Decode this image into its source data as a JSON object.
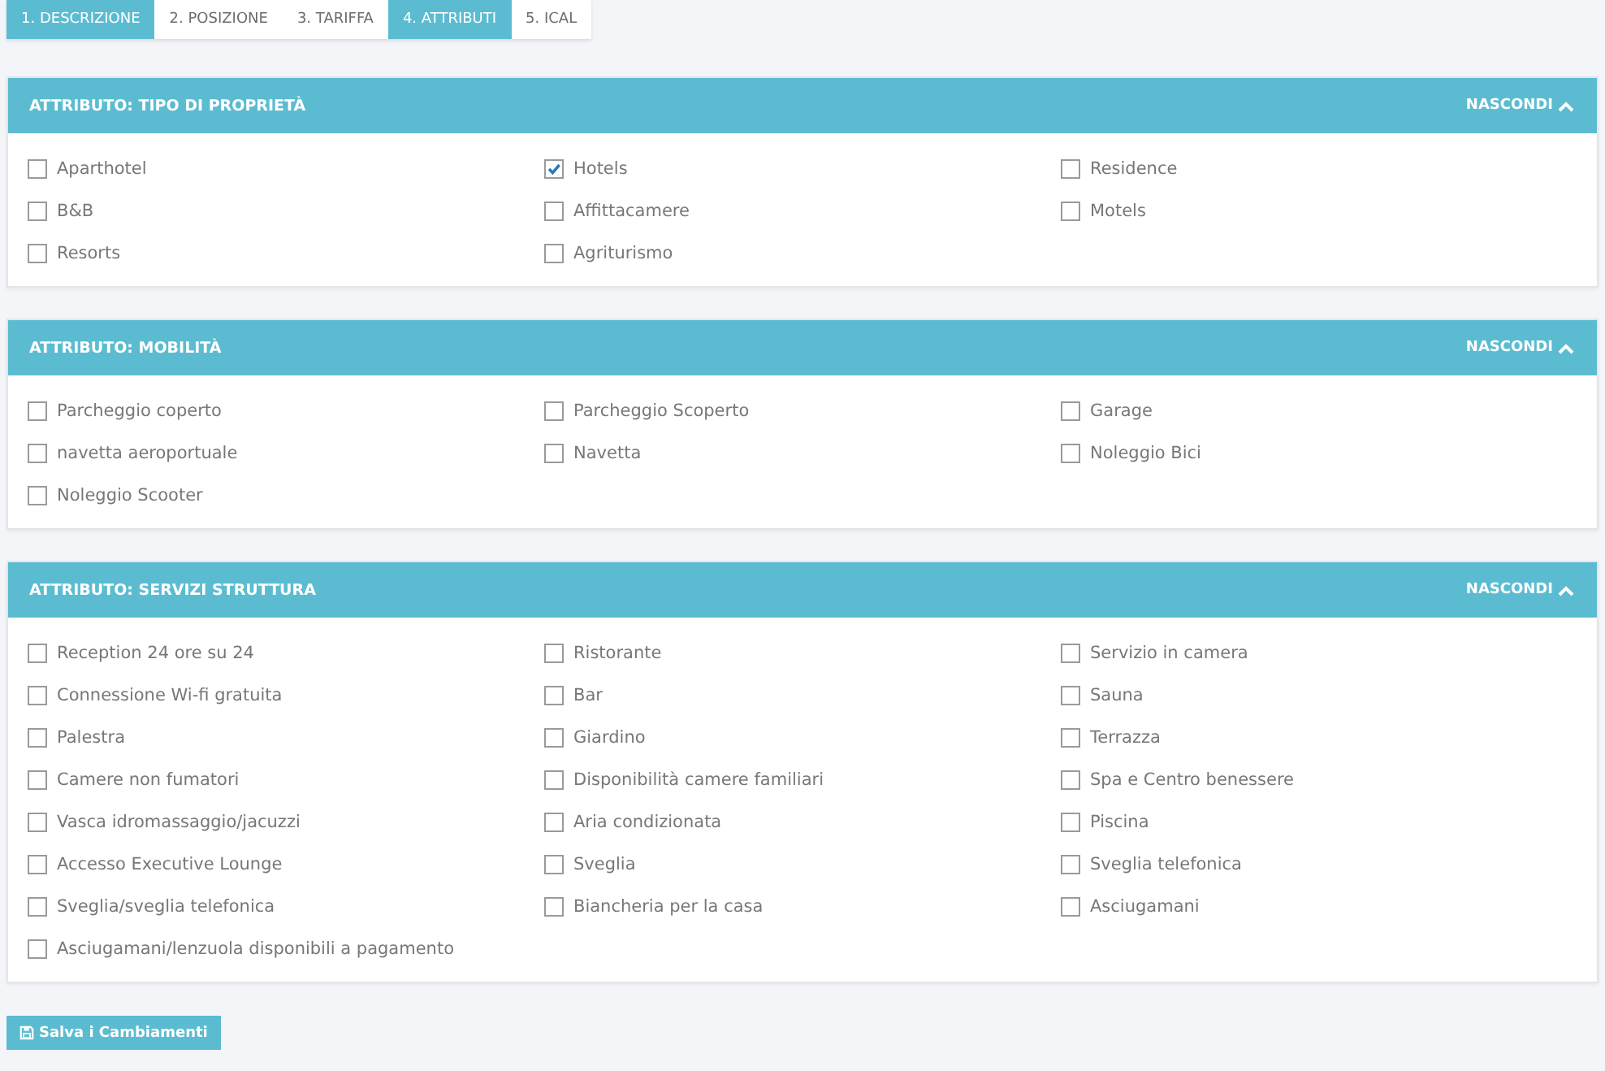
{
  "tabs": [
    {
      "label": "1. DESCRIZIONE",
      "selected": true
    },
    {
      "label": "2. POSIZIONE",
      "selected": false
    },
    {
      "label": "3. TARIFFA",
      "selected": false
    },
    {
      "label": "4. ATTRIBUTI",
      "selected": true
    },
    {
      "label": "5. ICAL",
      "selected": false
    }
  ],
  "panels": [
    {
      "title": "ATTRIBUTO: TIPO DI PROPRIETÀ",
      "toggle": "NASCONDI",
      "expanded": true,
      "options": [
        {
          "label": "Aparthotel",
          "checked": false
        },
        {
          "label": "Hotels",
          "checked": true
        },
        {
          "label": "Residence",
          "checked": false
        },
        {
          "label": "B&B",
          "checked": false
        },
        {
          "label": "Affittacamere",
          "checked": false
        },
        {
          "label": "Motels",
          "checked": false
        },
        {
          "label": "Resorts",
          "checked": false
        },
        {
          "label": "Agriturismo",
          "checked": false
        }
      ]
    },
    {
      "title": "ATTRIBUTO: MOBILITÀ",
      "toggle": "NASCONDI",
      "expanded": true,
      "options": [
        {
          "label": "Parcheggio coperto",
          "checked": false
        },
        {
          "label": "Parcheggio Scoperto",
          "checked": false
        },
        {
          "label": "Garage",
          "checked": false
        },
        {
          "label": "navetta aeroportuale",
          "checked": false
        },
        {
          "label": "Navetta",
          "checked": false
        },
        {
          "label": "Noleggio Bici",
          "checked": false
        },
        {
          "label": "Noleggio Scooter",
          "checked": false
        }
      ]
    },
    {
      "title": "ATTRIBUTO: SERVIZI STRUTTURA",
      "toggle": "NASCONDI",
      "expanded": true,
      "options": [
        {
          "label": "Reception 24 ore su 24",
          "checked": false
        },
        {
          "label": "Ristorante",
          "checked": false
        },
        {
          "label": "Servizio in camera",
          "checked": false
        },
        {
          "label": "Connessione Wi-fi gratuita",
          "checked": false
        },
        {
          "label": "Bar",
          "checked": false
        },
        {
          "label": "Sauna",
          "checked": false
        },
        {
          "label": "Palestra",
          "checked": false
        },
        {
          "label": "Giardino",
          "checked": false
        },
        {
          "label": "Terrazza",
          "checked": false
        },
        {
          "label": "Camere non fumatori",
          "checked": false
        },
        {
          "label": "Disponibilità camere familiari",
          "checked": false
        },
        {
          "label": "Spa e Centro benessere",
          "checked": false
        },
        {
          "label": "Vasca idromassaggio/jacuzzi",
          "checked": false
        },
        {
          "label": "Aria condizionata",
          "checked": false
        },
        {
          "label": "Piscina",
          "checked": false
        },
        {
          "label": "Accesso Executive Lounge",
          "checked": false
        },
        {
          "label": "Sveglia",
          "checked": false
        },
        {
          "label": "Sveglia telefonica",
          "checked": false
        },
        {
          "label": "Sveglia/sveglia telefonica",
          "checked": false
        },
        {
          "label": "Biancheria per la casa",
          "checked": false
        },
        {
          "label": "Asciugamani",
          "checked": false
        },
        {
          "label": "Asciugamani/lenzuola disponibili a pagamento",
          "checked": false
        }
      ]
    }
  ],
  "save_button": "Salva i Cambiamenti"
}
